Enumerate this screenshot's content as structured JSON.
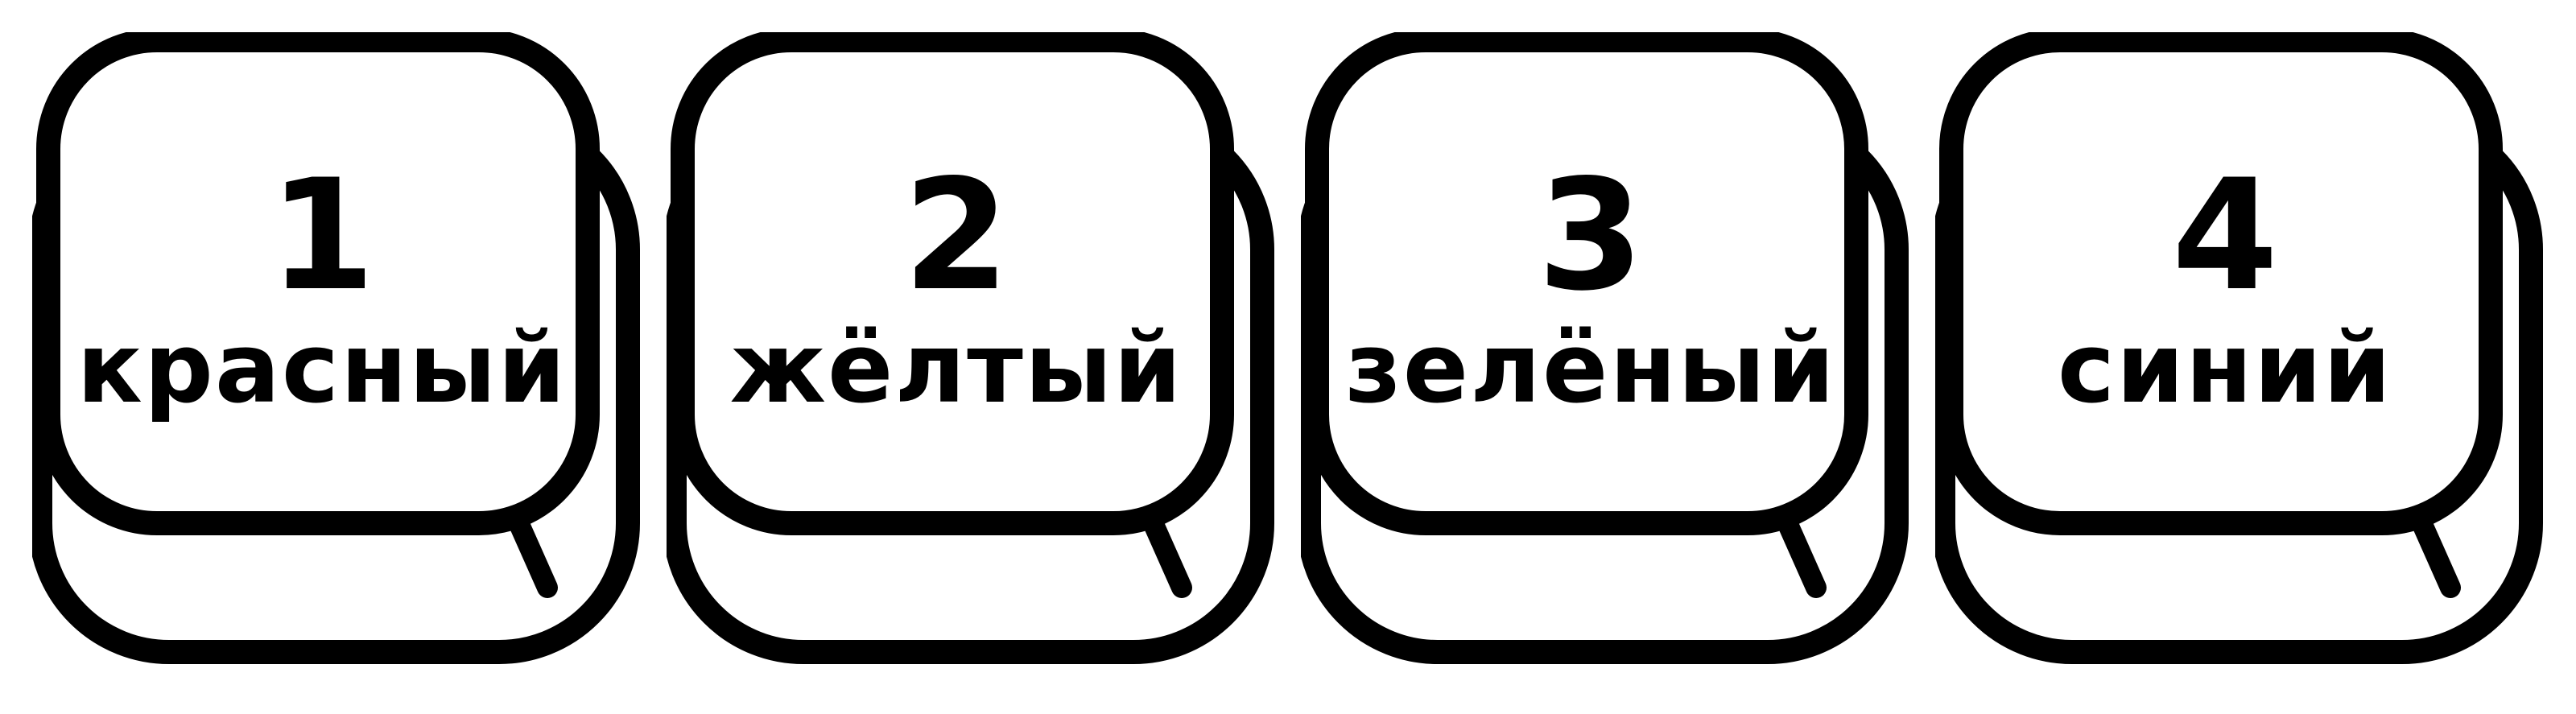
{
  "keys": [
    {
      "number": "1",
      "word": "красный"
    },
    {
      "number": "2",
      "word": "жёлтый"
    },
    {
      "number": "3",
      "word": "зелёный"
    },
    {
      "number": "4",
      "word": "синий"
    }
  ],
  "colors": {
    "outline": "#000000",
    "fill": "#ffffff"
  }
}
